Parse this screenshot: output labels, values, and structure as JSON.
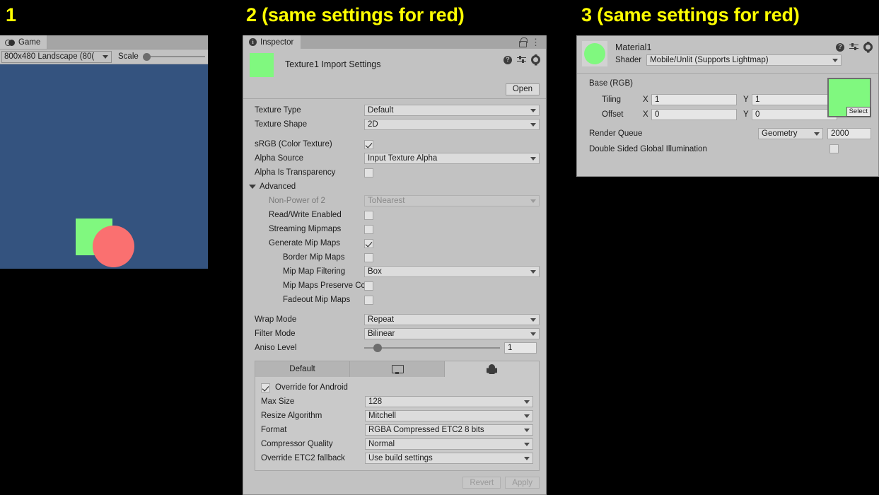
{
  "callouts": [
    {
      "text": "1"
    },
    {
      "text": "2 (same settings for red)"
    },
    {
      "text": "3 (same settings for red)"
    }
  ],
  "colors": {
    "panel_bg": "#c2c2c2",
    "game_bg": "#34537f",
    "green": "#80f87f",
    "red": "#fa7070",
    "callout": "#ffff00"
  },
  "game_view": {
    "tab_label": "Game",
    "tab_icon": "gamepad-icon",
    "resolution": "800x480 Landscape (80(",
    "scale_label": "Scale",
    "scale_value": 1
  },
  "inspector": {
    "tab_label": "Inspector",
    "tab_icon": "info-icon",
    "lock_icon": "lock-icon",
    "menu_icon": "kebab-menu-icon",
    "title": "Texture1 Import Settings",
    "help_icon": "help-icon",
    "preset_icon": "preset-icon",
    "settings_icon": "gear-icon",
    "open_button": "Open",
    "fields": {
      "texture_type_label": "Texture Type",
      "texture_type_value": "Default",
      "texture_shape_label": "Texture Shape",
      "texture_shape_value": "2D",
      "srgb_label": "sRGB (Color Texture)",
      "srgb_checked": true,
      "alpha_source_label": "Alpha Source",
      "alpha_source_value": "Input Texture Alpha",
      "alpha_transparency_label": "Alpha Is Transparency",
      "alpha_transparency_checked": false
    },
    "advanced": {
      "header": "Advanced",
      "npot_label": "Non-Power of 2",
      "npot_value": "ToNearest",
      "readwrite_label": "Read/Write Enabled",
      "readwrite_checked": false,
      "streaming_label": "Streaming Mipmaps",
      "streaming_checked": false,
      "generate_mips_label": "Generate Mip Maps",
      "generate_mips_checked": true,
      "border_mips_label": "Border Mip Maps",
      "border_mips_checked": false,
      "mip_filtering_label": "Mip Map Filtering",
      "mip_filtering_value": "Box",
      "preserve_coverage_label": "Mip Maps Preserve Cс",
      "preserve_coverage_checked": false,
      "fadeout_label": "Fadeout Mip Maps",
      "fadeout_checked": false
    },
    "sampling": {
      "wrap_mode_label": "Wrap Mode",
      "wrap_mode_value": "Repeat",
      "filter_mode_label": "Filter Mode",
      "filter_mode_value": "Bilinear",
      "aniso_label": "Aniso Level",
      "aniso_value": "1"
    },
    "platform": {
      "tabs": [
        {
          "label": "Default",
          "icon": "",
          "active": false
        },
        {
          "label": "",
          "icon": "monitor-icon",
          "active": false
        },
        {
          "label": "",
          "icon": "android-icon",
          "active": true
        }
      ],
      "override_label": "Override for Android",
      "override_checked": true,
      "max_size_label": "Max Size",
      "max_size_value": "128",
      "resize_label": "Resize Algorithm",
      "resize_value": "Mitchell",
      "format_label": "Format",
      "format_value": "RGBA Compressed ETC2 8 bits",
      "compressor_label": "Compressor Quality",
      "compressor_value": "Normal",
      "etc2_label": "Override ETC2 fallback",
      "etc2_value": "Use build settings"
    },
    "footer": {
      "revert_label": "Revert",
      "apply_label": "Apply",
      "revert_disabled": true,
      "apply_disabled": true
    }
  },
  "material": {
    "name": "Material1",
    "help_icon": "help-icon",
    "preset_icon": "preset-icon",
    "settings_icon": "gear-icon",
    "shader_label": "Shader",
    "shader_value": "Mobile/Unlit (Supports Lightmap)",
    "base_label": "Base (RGB)",
    "select_button": "Select",
    "tiling_label": "Tiling",
    "tiling_x_axis": "X",
    "tiling_x": "1",
    "tiling_y_axis": "Y",
    "tiling_y": "1",
    "offset_label": "Offset",
    "offset_x_axis": "X",
    "offset_x": "0",
    "offset_y_axis": "Y",
    "offset_y": "0",
    "render_queue_label": "Render Queue",
    "render_queue_value": "Geometry",
    "render_queue_number": "2000",
    "dsgi_label": "Double Sided Global Illumination",
    "dsgi_checked": false
  }
}
